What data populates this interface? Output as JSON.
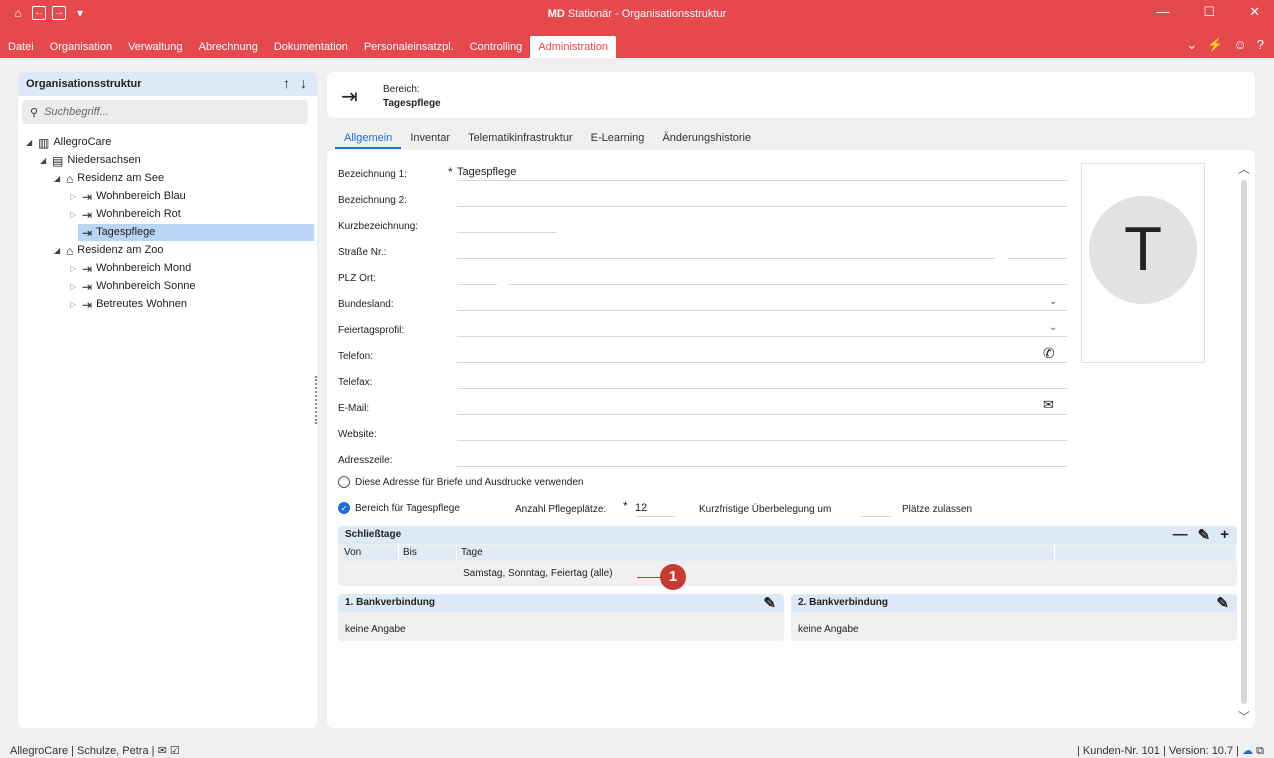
{
  "window": {
    "title_brand": "MD",
    "title_rest": " Stationär - Organisationsstruktur"
  },
  "menu": [
    {
      "label": "Datei"
    },
    {
      "label": "Organisation"
    },
    {
      "label": "Verwaltung"
    },
    {
      "label": "Abrechnung"
    },
    {
      "label": "Dokumentation"
    },
    {
      "label": "Personaleinsatzpl."
    },
    {
      "label": "Controlling"
    },
    {
      "label": "Administration"
    }
  ],
  "active_menu": "Administration",
  "left_panel": {
    "title": "Organisationsstruktur",
    "search_placeholder": "Suchbegriff...",
    "tree": [
      {
        "label": "AllegroCare",
        "icon": "company-icon"
      },
      {
        "label": "Niedersachsen",
        "icon": "region-icon"
      },
      {
        "label": "Residenz am See",
        "icon": "house-icon"
      },
      {
        "label": "Wohnbereich Blau",
        "icon": "area-icon"
      },
      {
        "label": "Wohnbereich Rot",
        "icon": "area-icon"
      },
      {
        "label": "Tagespflege",
        "icon": "area-icon",
        "selected": true
      },
      {
        "label": "Residenz am Zoo",
        "icon": "house-icon"
      },
      {
        "label": "Wohnbereich Mond",
        "icon": "area-icon"
      },
      {
        "label": "Wohnbereich Sonne",
        "icon": "area-icon"
      },
      {
        "label": "Betreutes Wohnen",
        "icon": "area-icon"
      }
    ]
  },
  "header": {
    "label": "Bereich:",
    "value": "Tagespflege"
  },
  "tabs": [
    "Allgemein",
    "Inventar",
    "Telematikinfrastruktur",
    "E-Learning",
    "Änderungshistorie"
  ],
  "form": {
    "bezeichnung1": {
      "label": "Bezeichnung 1:",
      "value": "Tagespflege"
    },
    "bezeichnung2": {
      "label": "Bezeichnung 2:",
      "value": ""
    },
    "kurz": {
      "label": "Kurzbezeichnung:",
      "value": ""
    },
    "strasse": {
      "label": "Straße Nr.:",
      "value": ""
    },
    "plz": {
      "label": "PLZ Ort:",
      "value": ""
    },
    "bundesland": {
      "label": "Bundesland:",
      "value": ""
    },
    "feiertag": {
      "label": "Feiertagsprofil:",
      "value": ""
    },
    "telefon": {
      "label": "Telefon:",
      "value": ""
    },
    "telefax": {
      "label": "Telefax:",
      "value": ""
    },
    "email": {
      "label": "E-Mail:",
      "value": ""
    },
    "website": {
      "label": "Website:",
      "value": ""
    },
    "adresszeile": {
      "label": "Adresszeile:",
      "value": ""
    },
    "required_mark": "*"
  },
  "avatar_letter": "T",
  "checkbox_adresse": "Diese Adresse für Briefe und Ausdrucke verwenden",
  "checkbox_tagespflege": "Bereich für Tagespflege",
  "pflegeplaetze_label": "Anzahl Pflegeplätze:",
  "pflegeplaetze_value": "12",
  "ueberbelegung_label": "Kurzfristige Überbelegung um",
  "ueberbelegung_suffix": "Plätze zulassen",
  "schliesstage": {
    "title": "Schließtage",
    "columns": [
      "Von",
      "Bis",
      "Tage"
    ],
    "row": {
      "von": "",
      "bis": "",
      "tage": "Samstag, Sonntag, Feiertag (alle)"
    }
  },
  "marker": "1",
  "bank1": {
    "title": "1. Bankverbindung",
    "value": "keine Angabe"
  },
  "bank2": {
    "title": "2. Bankverbindung",
    "value": "keine Angabe"
  },
  "status": {
    "left": "AllegroCare | Schulze, Petra |",
    "right": "| Kunden-Nr. 101 | Version: 10.7 |"
  },
  "colors": {
    "accent": "#e5484d",
    "primary": "#1d6ed6",
    "marker": "#c73a2f"
  }
}
